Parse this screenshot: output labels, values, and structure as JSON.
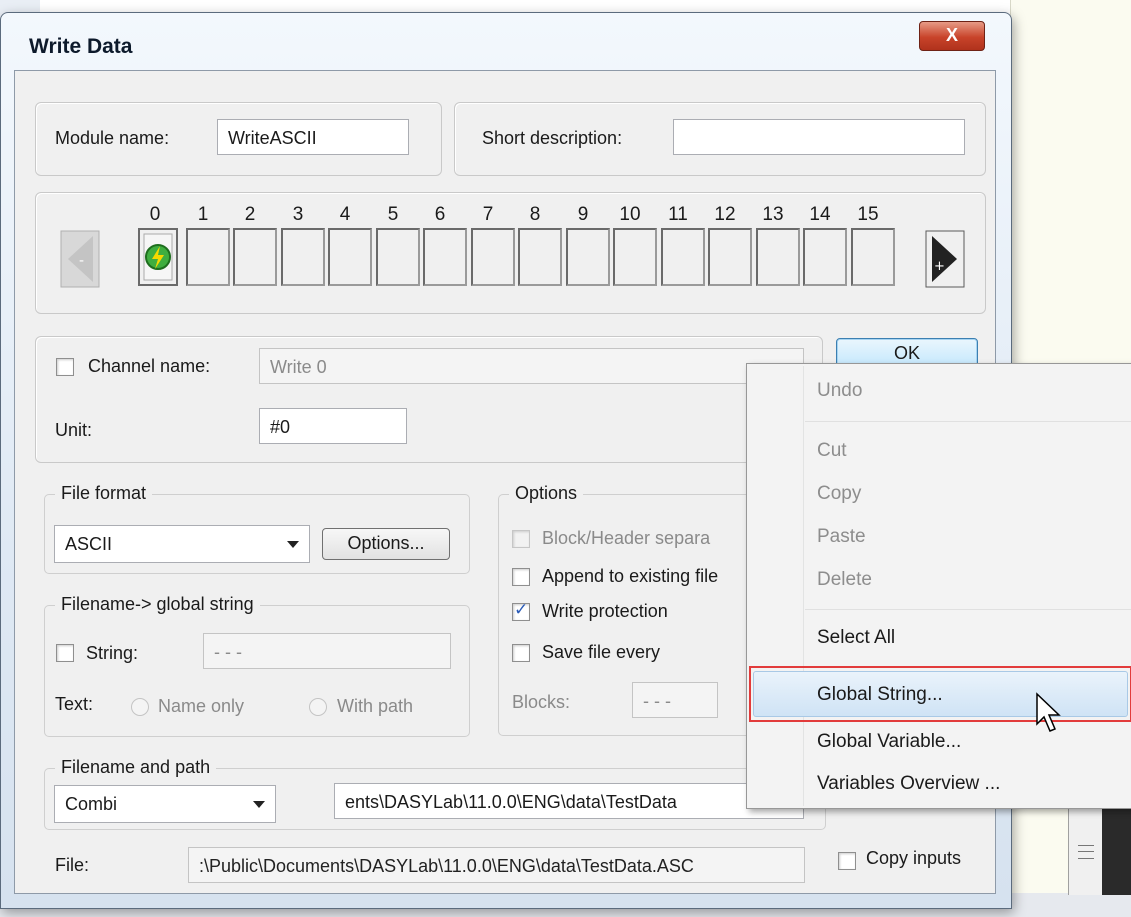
{
  "window": {
    "title": "Write Data",
    "close_glyph": "X"
  },
  "module": {
    "name_label": "Module name:",
    "name_value": "WriteASCII",
    "desc_label": "Short description:",
    "desc_value": ""
  },
  "channels": {
    "numbers": [
      "0",
      "1",
      "2",
      "3",
      "4",
      "5",
      "6",
      "7",
      "8",
      "9",
      "10",
      "11",
      "12",
      "13",
      "14",
      "15"
    ]
  },
  "channel": {
    "name_label": "Channel name:",
    "name_value": "Write 0",
    "unit_label": "Unit:",
    "unit_value": "#0"
  },
  "ok_label": "OK",
  "file_format": {
    "group_label": "File format",
    "selected": "ASCII",
    "options_button": "Options..."
  },
  "global_string": {
    "group_label": "Filename-> global string",
    "string_label": "String:",
    "string_value": "- - -",
    "text_label": "Text:",
    "name_only": "Name only",
    "with_path": "With path"
  },
  "options": {
    "group_label": "Options",
    "block_header": "Block/Header separa",
    "append": "Append to existing file",
    "write_protection": "Write protection",
    "save_every": "Save file every",
    "blocks_label": "Blocks:",
    "blocks_value": "- - -"
  },
  "path": {
    "group_label": "Filename and path",
    "selected": "Combi",
    "path_value": "ents\\DASYLab\\11.0.0\\ENG\\data\\TestData",
    "file_label": "File:",
    "file_value": ":\\Public\\Documents\\DASYLab\\11.0.0\\ENG\\data\\TestData.ASC",
    "copy_inputs": "Copy inputs"
  },
  "context_menu": {
    "undo": "Undo",
    "cut": "Cut",
    "copy": "Copy",
    "paste": "Paste",
    "delete": "Delete",
    "select_all": "Select All",
    "global_string": "Global String...",
    "global_variable": "Global Variable...",
    "variables_overview": "Variables Overview ..."
  },
  "colors": {
    "highlight_box": "#e23b3b",
    "close_button": "#c8432a",
    "check_blue": "#2a5bb8"
  }
}
